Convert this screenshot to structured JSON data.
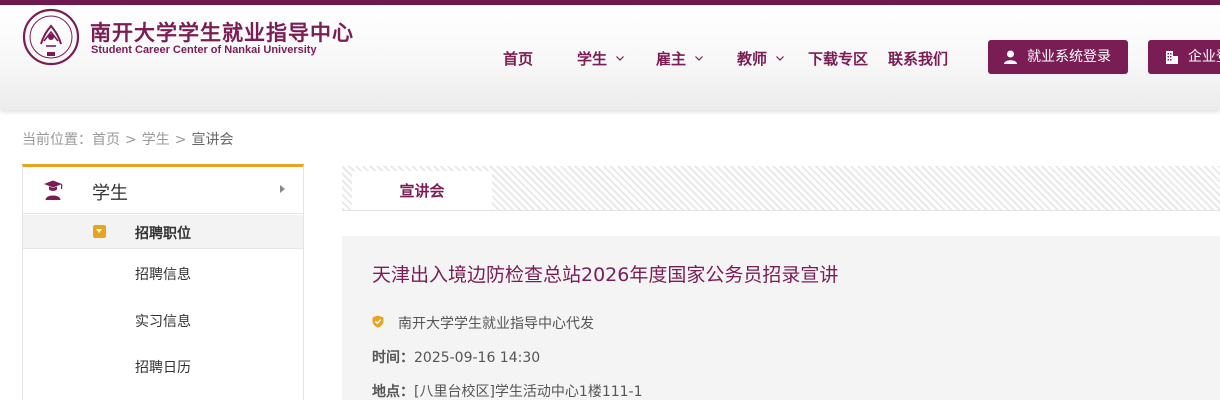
{
  "brand": {
    "name_cn": "南开大学学生就业指导中心",
    "name_en": "Student Career Center of Nankai University",
    "primary_color": "#7a1d55",
    "accent_color": "#eaa31f"
  },
  "nav": {
    "home": "首页",
    "students": "学生",
    "employers": "雇主",
    "teachers": "教师",
    "downloads": "下载专区",
    "contact": "联系我们"
  },
  "header_buttons": {
    "job_system_login": "就业系统登录",
    "enterprise_login": "企业登录"
  },
  "breadcrumb": {
    "prefix": "当前位置：",
    "home": "首页",
    "students": "学生",
    "current": "宣讲会",
    "separator": ">"
  },
  "sidebar": {
    "section_title": "学生",
    "section_icon": "student-graduate-icon",
    "subsection": "招聘职位",
    "links": [
      "招聘信息",
      "实习信息",
      "招聘日历"
    ]
  },
  "content": {
    "tab_label": "宣讲会",
    "article": {
      "title": "天津出入境边防检查总站2026年度国家公务员招录宣讲",
      "publisher": "南开大学学生就业指导中心代发",
      "time_label": "时间：",
      "time_value": "2025-09-16 14:30",
      "location_label": "地点：",
      "location_value": "[八里台校区]学生活动中心1楼111-1"
    }
  }
}
